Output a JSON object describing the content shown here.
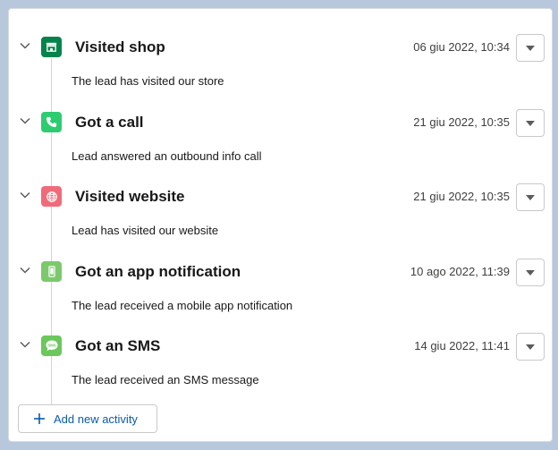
{
  "activities": [
    {
      "title": "Visited shop",
      "date": "06 giu 2022, 10:34",
      "description": "The lead has visited our store",
      "icon": "store-icon",
      "icon_color": "#04844b"
    },
    {
      "title": "Got a call",
      "date": "21 giu 2022, 10:35",
      "description": "Lead answered an outbound info call",
      "icon": "phone-icon",
      "icon_color": "#2ecc71"
    },
    {
      "title": "Visited website",
      "date": "21 giu 2022, 10:35",
      "description": "Lead has visited our website",
      "icon": "globe-icon",
      "icon_color": "#f06b7a"
    },
    {
      "title": "Got an app notification",
      "date": "10 ago 2022, 11:39",
      "description": "The lead received a mobile app notification",
      "icon": "mobile-icon",
      "icon_color": "#7cc96d"
    },
    {
      "title": "Got an SMS",
      "date": "14 giu 2022, 11:41",
      "description": "The lead received an SMS message",
      "icon": "sms-icon",
      "icon_color": "#6cc75d",
      "icon_text": "SMS"
    }
  ],
  "add_button": {
    "label": "Add new activity"
  },
  "colors": {
    "link": "#0b5cab",
    "timeline": "#d0d5dc"
  }
}
